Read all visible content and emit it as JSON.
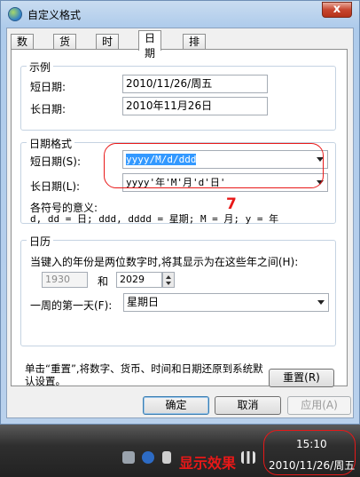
{
  "window": {
    "title": "自定义格式",
    "close_label": "x"
  },
  "tabs": [
    {
      "label": "数字"
    },
    {
      "label": "货币"
    },
    {
      "label": "时间"
    },
    {
      "label": "日期"
    },
    {
      "label": "排序"
    }
  ],
  "example": {
    "group_title": "示例",
    "short_label": "短日期:",
    "short_value": "2010/11/26/周五",
    "long_label": "长日期:",
    "long_value": "2010年11月26日"
  },
  "date_format": {
    "group_title": "日期格式",
    "short_label": "短日期(S):",
    "short_value": "yyyy/M/d/ddd",
    "long_label": "长日期(L):",
    "long_value": "yyyy'年'M'月'd'日'",
    "symbols_title": "各符号的意义:",
    "symbols_text": "d, dd = 日;  ddd, dddd = 星期;  M = 月; y = 年",
    "annotation_number": "7"
  },
  "calendar": {
    "group_title": "日历",
    "two_digit_label": "当键入的年份是两位数字时,将其显示为在这些年之间(H):",
    "year_from": "1930",
    "and_label": "和",
    "year_to": "2029",
    "first_day_label": "一周的第一天(F):",
    "first_day_value": "星期日"
  },
  "reset": {
    "hint": "单击“重置”,将数字、货币、时间和日期还原到系统默认设置。",
    "button_label": "重置(R)"
  },
  "dialog_buttons": {
    "ok": "确定",
    "cancel": "取消",
    "apply": "应用(A)"
  },
  "taskbar": {
    "show_effect": "显示效果",
    "clock_time": "15:10",
    "clock_date": "2010/11/26/周五"
  },
  "colors": {
    "annotation_red": "#e81818",
    "selection_blue": "#3399ff"
  }
}
